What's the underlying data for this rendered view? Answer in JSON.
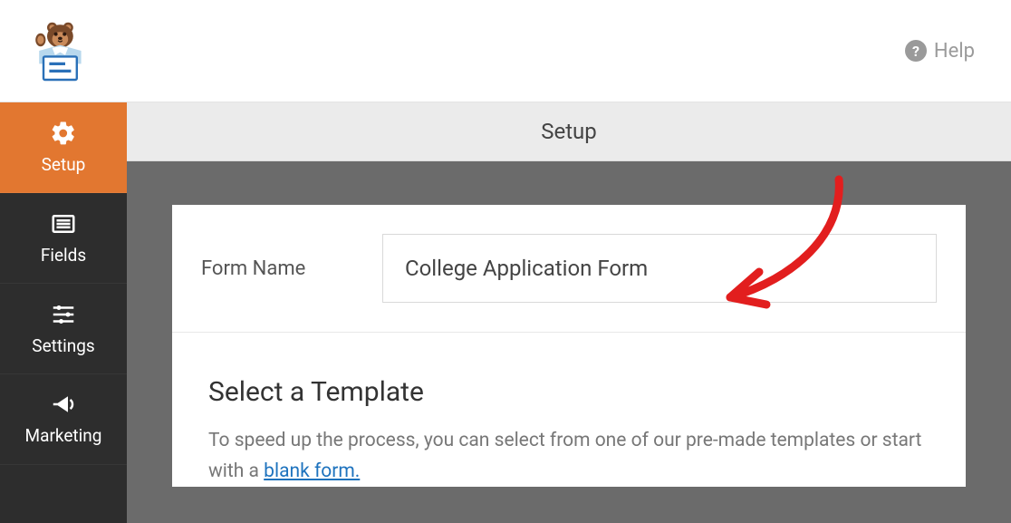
{
  "header": {
    "help_label": "Help"
  },
  "sidebar": {
    "items": [
      {
        "label": "Setup",
        "icon": "gear"
      },
      {
        "label": "Fields",
        "icon": "list"
      },
      {
        "label": "Settings",
        "icon": "sliders"
      },
      {
        "label": "Marketing",
        "icon": "megaphone"
      }
    ]
  },
  "content": {
    "header_title": "Setup",
    "form_name_label": "Form Name",
    "form_name_value": "College Application Form",
    "template_heading": "Select a Template",
    "template_desc_pre": "To speed up the process, you can select from one of our pre-made templates or start with a ",
    "blank_form_link": "blank form."
  }
}
